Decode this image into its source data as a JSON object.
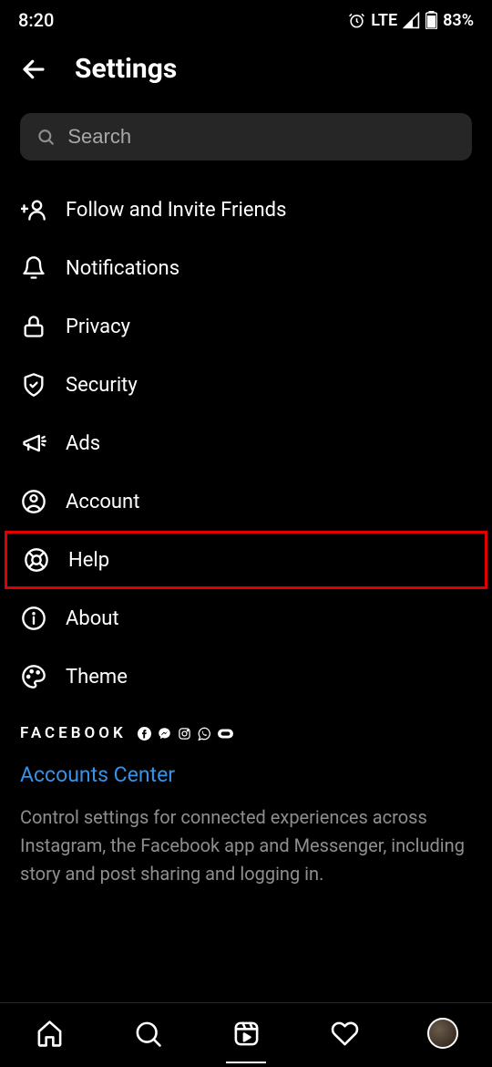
{
  "status": {
    "time": "8:20",
    "network": "LTE",
    "battery": "83%"
  },
  "header": {
    "title": "Settings"
  },
  "search": {
    "placeholder": "Search"
  },
  "menu": {
    "follow": "Follow and Invite Friends",
    "notifications": "Notifications",
    "privacy": "Privacy",
    "security": "Security",
    "ads": "Ads",
    "account": "Account",
    "help": "Help",
    "about": "About",
    "theme": "Theme"
  },
  "facebook": {
    "label": "FACEBOOK",
    "accounts_center": "Accounts Center",
    "description": "Control settings for connected experiences across Instagram, the Facebook app and Messenger, including story and post sharing and logging in."
  }
}
